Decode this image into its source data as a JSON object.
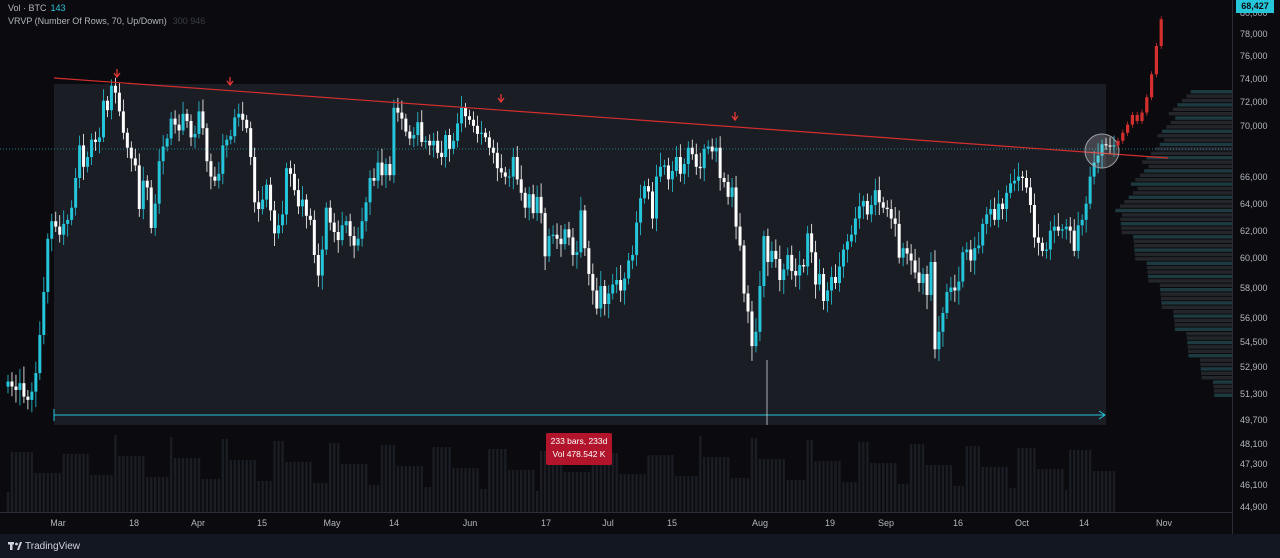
{
  "legend": {
    "vol_label": "Vol · BTC",
    "vol_value": "143",
    "vrvp_label": "VRVP (Number Of Rows, 70, Up/Down)",
    "vrvp_values": "300  946"
  },
  "price_axis": {
    "labels": [
      "80,000",
      "78,000",
      "76,000",
      "74,000",
      "72,000",
      "70,000",
      "68,427",
      "66,000",
      "64,000",
      "62,000",
      "60,000",
      "58,000",
      "56,000",
      "54,500",
      "52,900",
      "51,300",
      "49,700",
      "48,100",
      "47,300",
      "46,100",
      "44,900"
    ],
    "current_price": "68,427"
  },
  "time_axis": {
    "labels": [
      "Mar",
      "18",
      "Apr",
      "15",
      "May",
      "14",
      "Jun",
      "17",
      "Jul",
      "15",
      "Aug",
      "19",
      "Sep",
      "16",
      "Oct",
      "14",
      "Nov"
    ]
  },
  "range_tooltip": {
    "bars": "233 bars, 233d",
    "volume": "Vol 478.542 K"
  },
  "branding": {
    "name": "TradingView"
  },
  "colors": {
    "up": "#26c6da",
    "down": "#ffffff",
    "trendline": "#d32f2f",
    "projection": "#d32f2f",
    "range_fill": "#1e2129",
    "price_line": "#26c6da"
  },
  "chart_data": {
    "type": "candlestick",
    "symbol": "BTC",
    "ylim": [
      44900,
      80500
    ],
    "current_price": 68427,
    "descending_trendline": [
      {
        "date": "2024-03-05",
        "price": 74300
      },
      {
        "date": "2024-10-22",
        "price": 67500
      }
    ],
    "marked_peaks": [
      {
        "date": "2024-03-13",
        "price": 73800
      },
      {
        "date": "2024-04-08",
        "price": 72800
      },
      {
        "date": "2024-06-06",
        "price": 71900
      },
      {
        "date": "2024-07-29",
        "price": 70000
      }
    ],
    "measured_range": {
      "from": "2024-03-01",
      "to": "2024-10-20",
      "bars": 233,
      "volume_k": 478.542
    },
    "projection_path": [
      68800,
      69500,
      70200,
      71000,
      70500,
      71200,
      72500,
      74500,
      77000,
      79500
    ],
    "closes": [
      52100,
      51800,
      51600,
      52000,
      51200,
      51000,
      51500,
      52600,
      55000,
      57800,
      61500,
      62800,
      62400,
      61800,
      62600,
      62900,
      63800,
      66000,
      68400,
      66800,
      67500,
      68900,
      68700,
      69100,
      72200,
      71400,
      73500,
      72900,
      71300,
      69500,
      68200,
      67400,
      66900,
      63700,
      65800,
      65300,
      62300,
      64100,
      67200,
      68300,
      69000,
      70700,
      70200,
      69700,
      71100,
      70500,
      69100,
      69400,
      71300,
      69900,
      67200,
      66100,
      65800,
      66300,
      68400,
      68900,
      69200,
      70800,
      71100,
      70600,
      69900,
      67500,
      64200,
      63700,
      64400,
      65500,
      63600,
      61900,
      62500,
      63300,
      66700,
      66300,
      65100,
      63900,
      64400,
      63200,
      62900,
      60300,
      58900,
      60700,
      63800,
      62700,
      62000,
      61400,
      62500,
      62800,
      61700,
      61000,
      61500,
      62800,
      64200,
      66000,
      65800,
      67100,
      66200,
      67000,
      66200,
      71600,
      71200,
      70700,
      69600,
      69000,
      69300,
      70400,
      68700,
      68800,
      68400,
      68800,
      67800,
      67500,
      69300,
      68100,
      68800,
      70300,
      71600,
      70900,
      70600,
      70100,
      69400,
      69500,
      69100,
      68200,
      67800,
      66700,
      66400,
      66100,
      66100,
      67500,
      65900,
      64900,
      63800,
      64800,
      63400,
      64600,
      63400,
      60200,
      61700,
      61800,
      61500,
      61100,
      62200,
      61600,
      60300,
      60500,
      63600,
      60800,
      59000,
      57900,
      56700,
      58200,
      57000,
      57700,
      58300,
      58600,
      57900,
      58700,
      59900,
      60300,
      62700,
      64500,
      65400,
      65000,
      63000,
      66100,
      66800,
      66900,
      65900,
      66500,
      67500,
      66300,
      67000,
      68200,
      67700,
      66800,
      66700,
      68100,
      68300,
      67900,
      68200,
      66000,
      65700,
      64600,
      65300,
      62400,
      61000,
      57700,
      56500,
      54300,
      55200,
      58200,
      61700,
      59800,
      60600,
      60000,
      58600,
      59300,
      60300,
      59200,
      58900,
      59600,
      59500,
      61900,
      60500,
      58300,
      59000,
      57200,
      57900,
      58800,
      58400,
      59500,
      60700,
      61300,
      61800,
      63000,
      63900,
      64300,
      63300,
      64000,
      65100,
      64200,
      63800,
      63700,
      63000,
      62600,
      60100,
      60800,
      60400,
      59900,
      59100,
      58400,
      59000,
      57600,
      59800,
      54100,
      55200,
      56400,
      57800,
      58100,
      57900,
      58500,
      60500,
      60700,
      59900,
      60800,
      61000,
      62600,
      63300,
      63700,
      62900,
      64100,
      63700,
      64900,
      65600,
      65800,
      66100,
      66000,
      65300,
      64000,
      61600,
      61200,
      60600,
      60700,
      62100,
      62400,
      62100,
      62200,
      62400,
      62100,
      60600,
      62500,
      62900,
      64100,
      66100,
      67100,
      67600,
      68500,
      68400,
      68300,
      68400
    ]
  }
}
